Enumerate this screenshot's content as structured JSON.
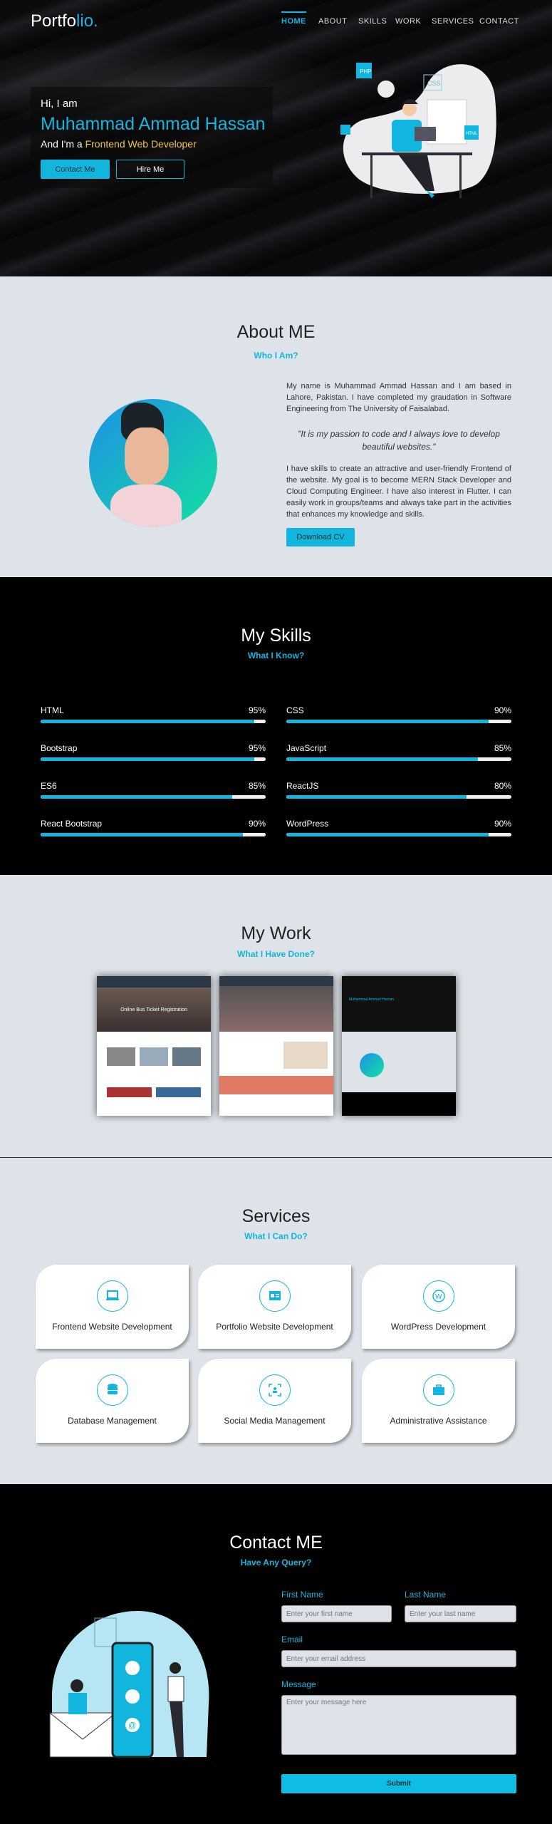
{
  "nav": {
    "logo_main": "Portfo",
    "logo_accent": "lio.",
    "items": [
      "HOME",
      "ABOUT",
      "SKILLS",
      "WORK",
      "SERVICES",
      "CONTACT"
    ],
    "active": "HOME"
  },
  "hero": {
    "greeting": "Hi, I am",
    "name": "Muhammad Ammad Hassan",
    "role_prefix": "And I'm a ",
    "role": "Frontend Web Developer",
    "contact_btn": "Contact Me",
    "hire_btn": "Hire Me",
    "illustration_tags": [
      "PHP",
      "CSS",
      "HTML"
    ]
  },
  "about": {
    "title": "About ME",
    "subtitle": "Who I Am?",
    "para1": "My name is Muhammad Ammad Hassan and I am based in Lahore, Pakistan. I have completed my graudation in Software Engineering from The University of Faisalabad.",
    "quote": "\"It is my passion to code and I always love to develop beautiful websites.\"",
    "para2": "I have skills to create an attractive and user-friendly Frontend of the website. My goal is to become MERN Stack Developer and Cloud Computing Engineer. I have also interest in Flutter. I can easily work in groups/teams and always take part in the activities that enhances my knowledge and skills.",
    "download_btn": "Download CV"
  },
  "skills": {
    "title": "My Skills",
    "subtitle": "What I Know?",
    "items": [
      {
        "name": "HTML",
        "percent": "95%",
        "value": 95
      },
      {
        "name": "CSS",
        "percent": "90%",
        "value": 90
      },
      {
        "name": "Bootstrap",
        "percent": "95%",
        "value": 95
      },
      {
        "name": "JavaScript",
        "percent": "85%",
        "value": 85
      },
      {
        "name": "ES6",
        "percent": "85%",
        "value": 85
      },
      {
        "name": "ReactJS",
        "percent": "80%",
        "value": 80
      },
      {
        "name": "React Bootstrap",
        "percent": "90%",
        "value": 90
      },
      {
        "name": "WordPress",
        "percent": "90%",
        "value": 90
      }
    ]
  },
  "work": {
    "title": "My Work",
    "subtitle": "What I Have Done?",
    "projects": [
      {
        "headline": "Online Bus Ticket Registration"
      },
      {
        "headline": ""
      },
      {
        "headline": "Muhammad Ammad Hassan"
      }
    ]
  },
  "services": {
    "title": "Services",
    "subtitle": "What I Can Do?",
    "items": [
      {
        "label": "Frontend Website Development",
        "icon": "laptop-code-icon"
      },
      {
        "label": "Portfolio Website Development",
        "icon": "id-card-icon"
      },
      {
        "label": "WordPress Development",
        "icon": "wordpress-icon"
      },
      {
        "label": "Database Management",
        "icon": "database-icon"
      },
      {
        "label": "Social Media Management",
        "icon": "users-scan-icon"
      },
      {
        "label": "Administrative Assistance",
        "icon": "briefcase-icon"
      }
    ]
  },
  "contact": {
    "title": "Contact ME",
    "subtitle": "Have Any Query?",
    "first_label": "First Name",
    "first_ph": "Enter your first name",
    "last_label": "Last Name",
    "last_ph": "Enter your last name",
    "email_label": "Email",
    "email_ph": "Enter your email address",
    "msg_label": "Message",
    "msg_ph": "Enter your message here",
    "submit": "Submit"
  },
  "colors": {
    "accent": "#12b5dd",
    "highlight": "#f0c44c",
    "light_bg": "#dde3e8",
    "dark_bg": "#000000"
  }
}
